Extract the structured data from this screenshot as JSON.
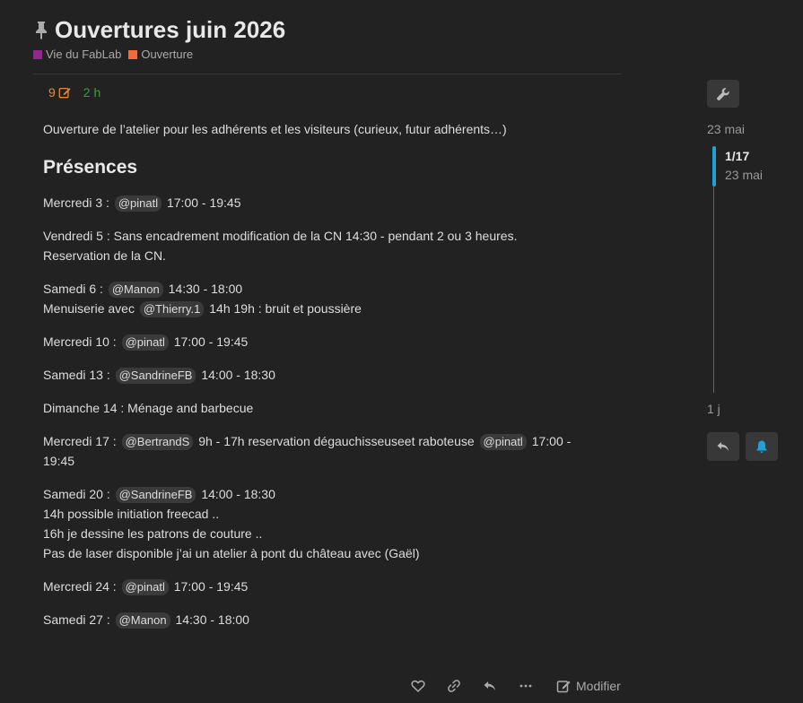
{
  "topic": {
    "title": "Ouvertures juin 2026",
    "categories": [
      {
        "label": "Vie du FabLab",
        "color": "#92278f"
      },
      {
        "label": "Ouverture",
        "color": "#f26b3a"
      }
    ]
  },
  "post": {
    "edit_count": "9",
    "age": "2 h",
    "intro": "Ouverture de l’atelier pour les adhérents et les visiteurs (curieux, futur adhérents…)",
    "section_title": "Présences",
    "entries": [
      {
        "l1_a": "Mercredi 3 :",
        "m1": "@pinatl",
        "l1_b": "17:00 - 19:45"
      },
      {
        "l1": "Vendredi 5 : Sans encadrement modification de la CN 14:30 - pendant 2 ou 3 heures.",
        "l2": "Reservation de la CN."
      },
      {
        "l1_a": "Samedi 6 :",
        "m1": "@Manon",
        "l1_b": "14:30 - 18:00",
        "l2_a": "Menuiserie avec",
        "m2": "@Thierry.1",
        "l2_b": "14h 19h : bruit et poussière"
      },
      {
        "l1_a": "Mercredi 10 :",
        "m1": "@pinatl",
        "l1_b": "17:00 - 19:45"
      },
      {
        "l1_a": "Samedi 13 :",
        "m1": "@SandrineFB",
        "l1_b": "14:00 - 18:30"
      },
      {
        "l1": "Dimanche 14 : Ménage and barbecue"
      },
      {
        "l1_a": "Mercredi 17 :",
        "m1": "@BertrandS",
        "l1_b": "9h - 17h reservation dégauchisseuseet raboteuse",
        "m2": "@pinatl",
        "l1_c": "17:00 -",
        "l2": "19:45"
      },
      {
        "l1_a": "Samedi 20 :",
        "m1": "@SandrineFB",
        "l1_b": "14:00 - 18:30",
        "l2": "14h possible initiation freecad ..",
        "l3": "16h je dessine les patrons de couture ..",
        "l4": "Pas de laser disponible j’ai un atelier à pont du château avec (Gaël)"
      },
      {
        "l1_a": "Mercredi 24 :",
        "m1": "@pinatl",
        "l1_b": "17:00 - 19:45"
      },
      {
        "l1_a": "Samedi 27 :",
        "m1": "@Manon",
        "l1_b": "14:30 - 18:00"
      }
    ]
  },
  "actions": {
    "like_icon": "heart-icon",
    "link_icon": "link-icon",
    "reply_icon": "reply-icon",
    "more_icon": "ellipsis-icon",
    "edit_label": "Modifier"
  },
  "timeline": {
    "start_date": "23 mai",
    "position": "1/17",
    "position_date": "23 mai",
    "end_label": "1 j",
    "progress_fraction": 0.0588
  },
  "colors": {
    "accent": "#1fa0d6",
    "edits": "#e88a2a",
    "age": "#3f9b3f"
  }
}
